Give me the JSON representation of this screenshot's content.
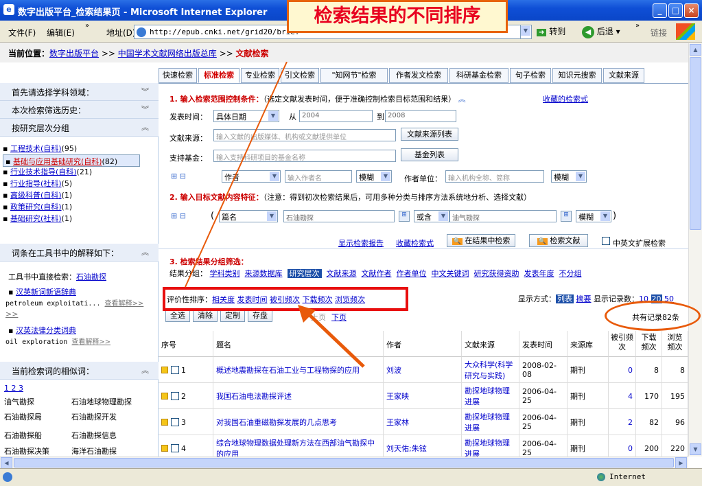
{
  "window": {
    "title": "数字出版平台_检索结果页 - Microsoft Internet Explorer",
    "min": "_",
    "max": "□",
    "close": "×"
  },
  "callout": "检索结果的不同排序",
  "menu": {
    "file": "文件(F)",
    "edit": "编辑(E)",
    "more": "»",
    "address_label": "地址(D)",
    "address_url": "http://epub.cnki.net/grid20/brief",
    "go": "转到",
    "back": "后退",
    "links": "链接"
  },
  "breadcrumb": {
    "prefix": "当前位置：",
    "items": [
      "数字出版平台",
      "中国学术文献网络出版总库",
      "文献检索"
    ],
    "sep": " >> "
  },
  "tabs": [
    "快速检索",
    "标准检索",
    "专业检索",
    "引文检索",
    "\"知网节\"检索",
    "作者发文检索",
    "科研基金检索",
    "句子检索",
    "知识元搜索",
    "文献来源"
  ],
  "sidebar": {
    "head1": "首先请选择学科领域：",
    "head2": "本次检索筛选历史：",
    "head3": "按研究层次分组",
    "groups": [
      {
        "label": "工程技术(自科)",
        "count": "(95)"
      },
      {
        "label": "基础与应用基础研究(自科)",
        "count": "(82)"
      },
      {
        "label": "行业技术指导(自科)",
        "count": "(21)"
      },
      {
        "label": "行业指导(社科)",
        "count": "(5)"
      },
      {
        "label": "高级科普(自科)",
        "count": "(1)"
      },
      {
        "label": "政策研究(自科)",
        "count": "(1)"
      },
      {
        "label": "基础研究(社科)",
        "count": "(1)"
      }
    ],
    "tool_head": "词条在工具书中的解释如下：",
    "tool_direct": "工具书中直接检索：",
    "tool_term": "石油勘探",
    "dict1": "汉英新词新语辞典",
    "dict1_text": "petroleum exploitati...",
    "dict2": "汉英法律分类词典",
    "dict2_text": "oil exploration",
    "view_more": "查看解释>>",
    "view_more2": ">>",
    "similar_head": "当前检索词的相似词：",
    "pages": "1 2 3",
    "similar": [
      [
        "油气勘探",
        "石油地球物理勘探"
      ],
      [
        "石油勘探局",
        "石油勘探开发"
      ],
      [
        "石油勘探船",
        "石油勘探信息"
      ],
      [
        "石油勘探决策",
        "海洋石油勘探"
      ]
    ]
  },
  "main": {
    "sec1": "1. 输入检索范围控制条件：",
    "sec1_note": "（选定文献发表时间，便于准确控制检索目标范围和结果）",
    "saved": "收藏的检索式",
    "date_label": "发表时间：",
    "date_type": "具体日期",
    "from_label": "从",
    "from": "2004",
    "to_label": "到",
    "to": "2008",
    "source_label": "文献来源：",
    "source_ph": "输入文献的出版媒体、机构或文献提供单位",
    "source_btn": "文献来源列表",
    "fund_label": "支持基金：",
    "fund_ph": "输入支持科研项目的基金名称",
    "fund_btn": "基金列表",
    "author_field": "作者",
    "author_ph": "输入作者名",
    "fuzzy": "模糊",
    "unit_label": "作者单位：",
    "unit_ph": "输入机构全称、简称",
    "sec2": "2. 输入目标文献内容特征：",
    "sec2_note": "（注意：得到初次检索结果后，可用多种分类与排序方法系统地分析、选择文献）",
    "field": "篇名",
    "kw1": "石油勘探",
    "op": "或含",
    "kw2": "油气勘探",
    "show_report": "显示检索报告",
    "save_query": "收藏检索式",
    "search_in": "在结果中检索",
    "search": "检索文献",
    "expand": "中英文扩展检索",
    "sec3": "3. 检索结果分组筛选：",
    "group_label": "结果分组：",
    "groups": [
      "学科类别",
      "来源数据库",
      "研究层次",
      "文献来源",
      "文献作者",
      "作者单位",
      "中文关键词",
      "研究获得资助",
      "发表年度",
      "不分组"
    ],
    "sort_label": "评价性排序：",
    "sorts": [
      "相关度",
      "发表时间",
      "被引频次",
      "下载频次",
      "浏览频次"
    ],
    "display_label": "显示方式：",
    "display_list": "列表",
    "display_abs": "摘要",
    "count_label": "显示记录数：",
    "counts": [
      "10",
      "20",
      "50"
    ],
    "btns": [
      "全选",
      "清除",
      "定制",
      "存盘"
    ],
    "prev": "上页",
    "next": "下页",
    "total": "共有记录82条"
  },
  "table": {
    "headers": [
      "序号",
      "题名",
      "作者",
      "文献来源",
      "发表时间",
      "来源库",
      "被引频次",
      "下载频次",
      "浏览频次"
    ],
    "rows": [
      {
        "n": "1",
        "title": "概述地震勘探在石油工业与工程物探的应用",
        "author": "刘波",
        "source": "大众科学(科学研究与实践)",
        "date": "2008-02-08",
        "db": "期刊",
        "cited": "0",
        "dl": "8",
        "view": "8"
      },
      {
        "n": "2",
        "title": "我国石油电法勘探评述",
        "author": "王家映",
        "source": "勘探地球物理进展",
        "date": "2006-04-25",
        "db": "期刊",
        "cited": "4",
        "dl": "170",
        "view": "195"
      },
      {
        "n": "3",
        "title": "对我国石油重磁勘探发展的几点思考",
        "author": "王家林",
        "source": "勘探地球物理进展",
        "date": "2006-04-25",
        "db": "期刊",
        "cited": "2",
        "dl": "82",
        "view": "96"
      },
      {
        "n": "4",
        "title": "综合地球物理数据处理新方法在西部油气勘探中的应用",
        "author": "刘天佑;朱铉",
        "source": "勘探地球物理进展",
        "date": "2006-04-25",
        "db": "期刊",
        "cited": "0",
        "dl": "200",
        "view": "220"
      }
    ]
  },
  "status": {
    "zone": "Internet"
  }
}
